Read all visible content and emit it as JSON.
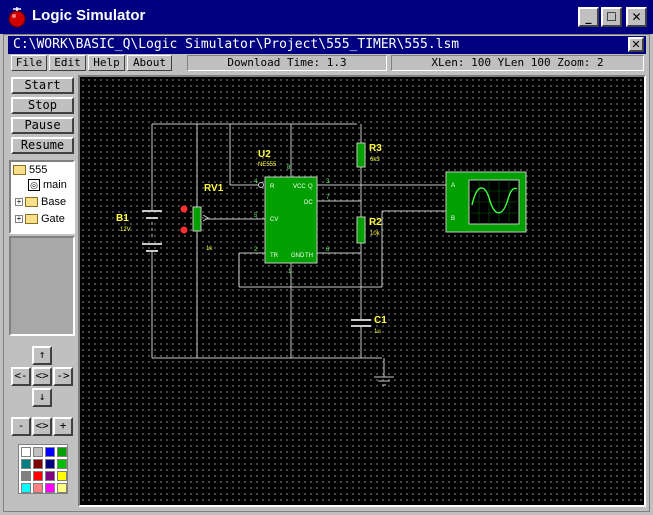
{
  "window": {
    "title": "Logic Simulator",
    "minimize": "_",
    "maximize": "☐",
    "close": "✕"
  },
  "document": {
    "path": "C:\\WORK\\BASIC_Q\\Logic Simulator\\Project\\555_TIMER\\555.lsm",
    "close": "✕"
  },
  "menu": {
    "file": "File",
    "edit": "Edit",
    "help": "Help",
    "about": "About"
  },
  "status": {
    "download": "Download Time: 1.3",
    "dims": "XLen: 100 YLen 100 Zoom: 2"
  },
  "controls": {
    "start": "Start",
    "stop": "Stop",
    "pause": "Pause",
    "resume": "Resume"
  },
  "tree": {
    "root": "555",
    "main": "main",
    "base": "Base",
    "gate": "Gate",
    "expand": "+"
  },
  "nav": {
    "up": "↑",
    "left": "<-",
    "center": "<>",
    "right": "->",
    "down": "↓",
    "zoom_out": "-",
    "zoom_reset": "<>",
    "zoom_in": "+"
  },
  "palette": [
    "#ffffff",
    "#c0c0c0",
    "#0000ff",
    "#00a000",
    "#008080",
    "#800000",
    "#000080",
    "#00c000",
    "#808080",
    "#ff0000",
    "#800080",
    "#ffff00",
    "#00ffff",
    "#ff8080",
    "#ff00ff",
    "#ffff80"
  ],
  "circuit": {
    "colors": {
      "wire": "#c8c8c8",
      "component": "#00a000",
      "label": "#ffff40",
      "dot": "#ff3030"
    },
    "u2": {
      "ref": "U2",
      "part": "NE555",
      "pin_r": "R",
      "pin_vcc": "VCC",
      "pin_q": "Q",
      "pin_dc": "DC",
      "pin_cv": "CV",
      "pin_tr": "TR",
      "pin_gnd": "GND",
      "pin_th": "TH",
      "n4": "4",
      "n8": "8",
      "n3": "3",
      "n7": "7",
      "n5": "5",
      "n2": "2",
      "n1": "1",
      "n6": "6"
    },
    "b1": {
      "ref": "B1",
      "value": "12V"
    },
    "rv1": {
      "ref": "RV1",
      "value": "1k"
    },
    "r3": {
      "ref": "R3",
      "value": "6k3"
    },
    "r2": {
      "ref": "R2",
      "value": "10k"
    },
    "c1": {
      "ref": "C1",
      "value": "1u"
    },
    "scope": {
      "a": "A",
      "b": "B"
    }
  }
}
